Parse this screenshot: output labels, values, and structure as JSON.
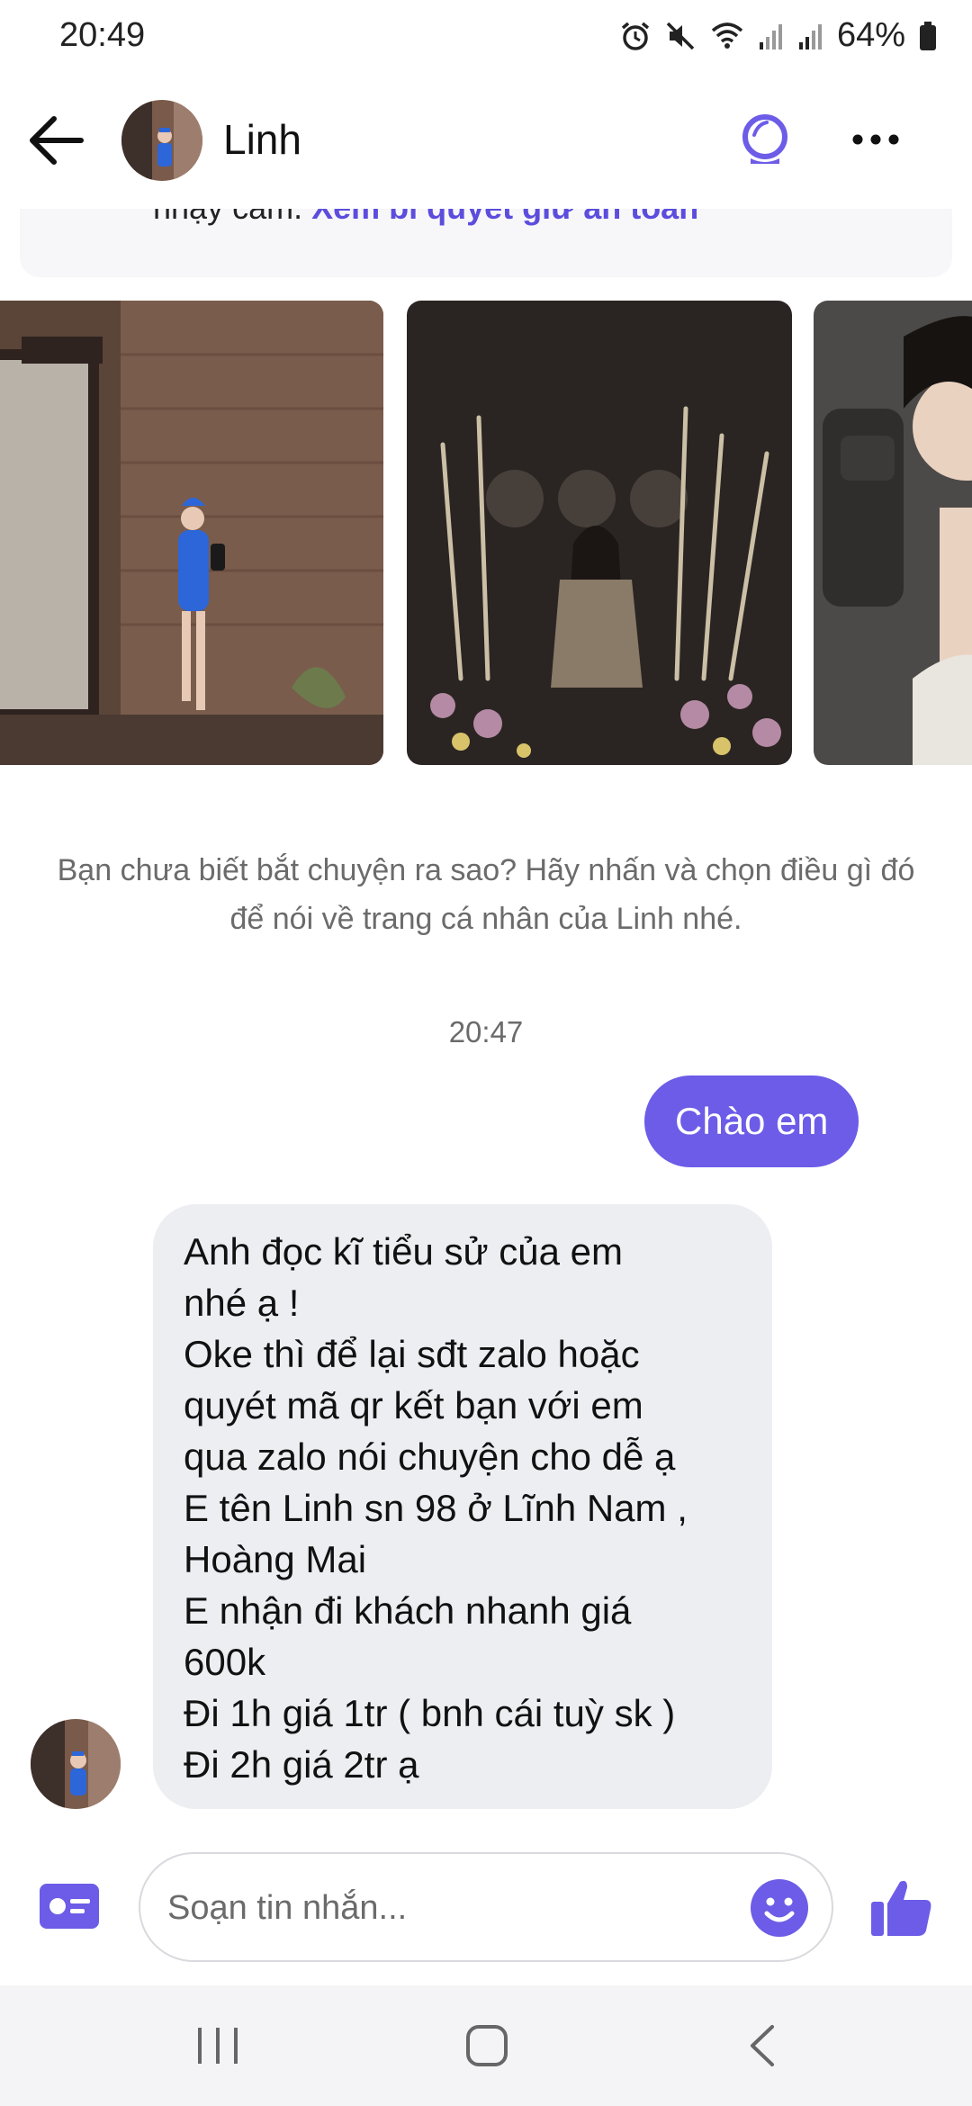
{
  "status_bar": {
    "time": "20:49",
    "battery": "64%",
    "icons": [
      "alarm-icon",
      "mute-icon",
      "wifi-icon",
      "signal-icon",
      "signal-icon",
      "battery-icon"
    ]
  },
  "header": {
    "contact_name": "Linh",
    "icons": [
      "back-arrow-icon",
      "avatar",
      "chat-bubble-icon",
      "more-icon"
    ]
  },
  "safety_banner": {
    "text": "nhạy cảm. ",
    "link": "Xem bí quyết giữ an toàn"
  },
  "photos": [
    "profile-photo",
    "profile-photo",
    "profile-photo"
  ],
  "conversation_prompt": "Bạn chưa biết bắt chuyện ra sao? Hãy nhấn và chọn điều gì đó để nói về trang cá nhân của Linh nhé.",
  "timestamp": "20:47",
  "messages": {
    "outgoing": "Chào em",
    "incoming_lines": [
      "Anh đọc kĩ tiểu sử của em",
      "nhé ạ !",
      "Oke thì để lại sđt zalo hoặc",
      "quyét mã qr kết bạn với em",
      "qua zalo nói chuyện cho dễ ạ",
      "E tên Linh sn 98 ở Lĩnh Nam ,",
      "Hoàng Mai",
      "E nhận đi khách nhanh giá",
      "600k",
      "Đi 1h giá 1tr ( bnh cái tuỳ sk )",
      "Đi 2h giá 2tr ạ"
    ]
  },
  "composer": {
    "placeholder": "Soạn tin nhắn..."
  },
  "colors": {
    "accent": "#6c5ce7",
    "incoming_bubble": "#eceef2",
    "muted_text": "#6b6b6b"
  }
}
